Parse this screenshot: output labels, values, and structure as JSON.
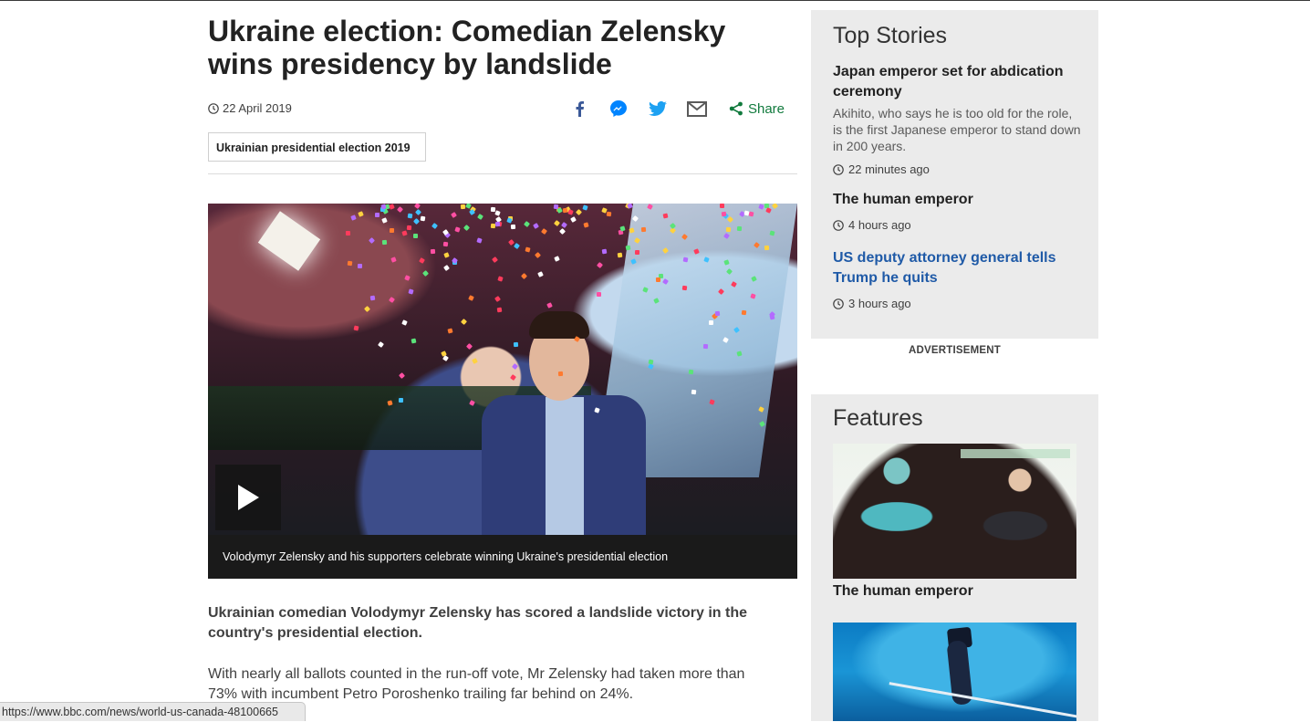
{
  "article": {
    "headline": "Ukraine election: Comedian Zelensky wins presidency by landslide",
    "date": "22 April 2019",
    "share_label": "Share",
    "tag": "Ukrainian presidential election 2019",
    "caption": "Volodymyr Zelensky and his supporters celebrate winning Ukraine's presidential election",
    "lede": "Ukrainian comedian Volodymyr Zelensky has scored a landslide victory in the country's presidential election.",
    "paragraph": "With nearly all ballots counted in the run-off vote, Mr Zelensky had taken more than 73% with incumbent Petro Poroshenko trailing far behind on 24%."
  },
  "share_icons": [
    "facebook-icon",
    "messenger-icon",
    "twitter-icon",
    "email-icon",
    "share-icon"
  ],
  "sidebar": {
    "top_stories_title": "Top Stories",
    "stories": [
      {
        "title": "Japan emperor set for abdication ceremony",
        "summary": "Akihito, who says he is too old for the role, is the first Japanese emperor to stand down in 200 years.",
        "time": "22 minutes ago"
      },
      {
        "title": "The human emperor",
        "time": "4 hours ago"
      },
      {
        "title": "US deputy attorney general tells Trump he quits",
        "time": "3 hours ago"
      }
    ],
    "advertisement_label": "ADVERTISEMENT",
    "features_title": "Features",
    "features": [
      {
        "title": "The human emperor"
      }
    ]
  },
  "status_bar": {
    "url": "https://www.bbc.com/news/world-us-canada-48100665"
  },
  "colors": {
    "facebook": "#3b5998",
    "messenger": "#0084ff",
    "twitter": "#1da1f2",
    "share_green": "#117a3d",
    "link_blue": "#1f5aa7",
    "sidebar_bg": "#ebebeb"
  }
}
